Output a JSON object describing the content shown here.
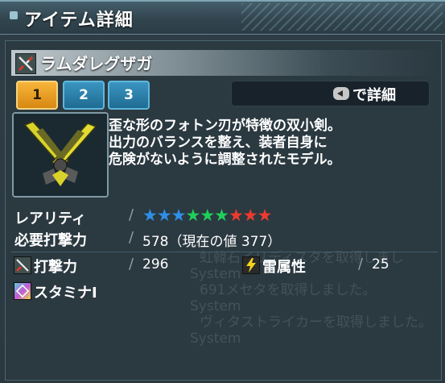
{
  "window": {
    "title": "アイテム詳細"
  },
  "item": {
    "name": "ラムダレグザガ",
    "weapon_icon": "twin-dagger-icon"
  },
  "tabs": [
    {
      "label": "1",
      "active": true
    },
    {
      "label": "2",
      "active": false
    },
    {
      "label": "3",
      "active": false
    }
  ],
  "detail_button": {
    "key_icon": "key-button-icon",
    "label": "で詳細"
  },
  "description": [
    "歪な形のフォトン刃が特徴の双小剣。",
    "出力のバランスを整え、装者自身に",
    "危険がないように調整されたモデル。"
  ],
  "stats": {
    "rarity_label": "レアリティ",
    "rarity": 9,
    "rarity_max": 9,
    "star_colors": [
      "#2f8fe8",
      "#2f8fe8",
      "#2f8fe8",
      "#1fcf5a",
      "#1fcf5a",
      "#1fcf5a",
      "#ee3a2e",
      "#ee3a2e",
      "#ee3a2e"
    ],
    "required_label": "必要打撃力",
    "required_value": "578（現在の値 377）",
    "attack_label": "打撃力",
    "attack_value": "296",
    "element_label": "雷属性",
    "element_value": "25",
    "ability_label": "スタミナI"
  },
  "chat_background": [
    "System",
    "ヴィタストライカーを取得しました。",
    "System",
    "691メセタを取得しました。",
    "System",
    "虹韓石イリディスタを取得しまし",
    "System",
    "System"
  ],
  "colors": {
    "accent_tab": "#f4a52a",
    "inactive_tab": "#2f86b3"
  }
}
